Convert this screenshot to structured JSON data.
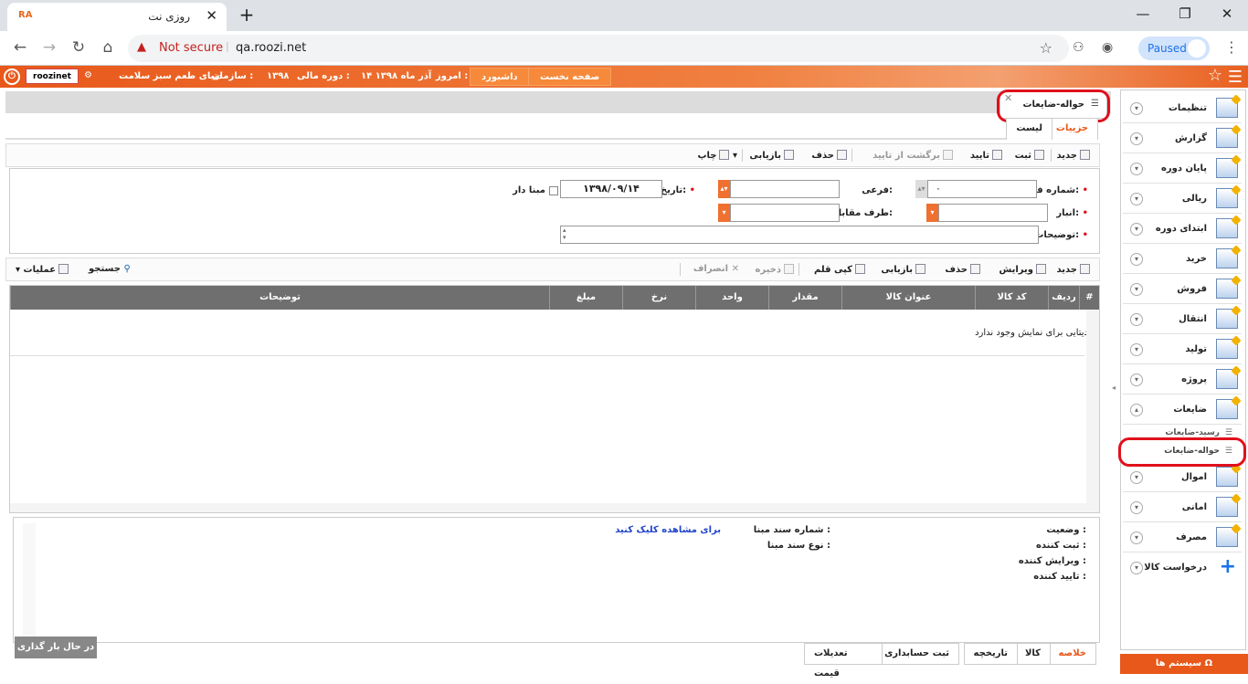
{
  "browser": {
    "tab_favicon": "RA",
    "tab_title": "روزی نت",
    "url": "qa.roozi.net",
    "security": "Not secure",
    "profile": "Paused",
    "win_min": "—",
    "win_max": "❐",
    "win_close": "✕"
  },
  "app": {
    "user": "roozinet",
    "organization_label": "سازمان :",
    "organization": "دنیای طعم سبز سلامت",
    "period_label": "دوره مالی :",
    "period": "۱۳۹۸",
    "today_label": "امروز :",
    "today": "۱۴ آذر ماه ۱۳۹۸",
    "dashboard": "داشبورد",
    "home": "صفحه نخست"
  },
  "page": {
    "tab_title": "حواله-ضایعات",
    "subtab_details": "جزییات",
    "subtab_list": "لیست"
  },
  "toolbar": {
    "new": "جدید",
    "save": "ثبت",
    "approve": "تایید",
    "unapprove": "برگشت از تایید",
    "delete": "حذف",
    "refresh": "بازیابی",
    "print": "چاپ"
  },
  "form": {
    "form_number_label": "شماره فرم:",
    "form_number_value": "۰",
    "sub_label": "فرعی:",
    "date_label": "تاریخ:",
    "date_value": "۱۳۹۸/۰۹/۱۴",
    "base_label": "مبنا دار",
    "warehouse_label": "انبار:",
    "party_label": "طرف مقابل:",
    "desc_label": "توضیحات:"
  },
  "grid_toolbar": {
    "new": "جدید",
    "edit": "ویرایش",
    "delete": "حذف",
    "refresh": "بازیابی",
    "copy": "کپی قلم",
    "save": "ذخیره",
    "cancel": "انصراف",
    "search": "جستجو",
    "ops": "عملیات"
  },
  "grid": {
    "columns": [
      "#",
      "ردیف",
      "کد کالا",
      "عنوان کالا",
      "مقدار",
      "واحد",
      "نرخ",
      "مبلغ",
      "توضیحات"
    ],
    "empty": "دیتایی برای نمایش وجود ندارد"
  },
  "summary": {
    "status": "وضعیت :",
    "creator": "ثبت کننده :",
    "editor": "ویرایش کننده :",
    "approver": "تایید کننده :",
    "base_doc_no": "شماره سند مبنا :",
    "base_doc_type": "نوع سند مبنا :",
    "view_link": "برای مشاهده کلیک کنید"
  },
  "loading": "در حال بار گذاری ...",
  "bottom_tabs": [
    "خلاصه",
    "کالا",
    "تاریخچه",
    "ثبت حسابداری",
    "تعدیلات قیمت"
  ],
  "sidebar": {
    "items": [
      "تنظیمات",
      "گزارش",
      "پایان دوره",
      "ریالی",
      "ابتدای دوره",
      "خرید",
      "فروش",
      "انتقال",
      "تولید",
      "پروژه",
      "ضایعات",
      "اموال",
      "امانی",
      "مصرف",
      "درخواست کالا"
    ],
    "sub": [
      "رسید-ضایعات",
      "حواله-ضایعات"
    ],
    "system": "سیستم ها"
  }
}
